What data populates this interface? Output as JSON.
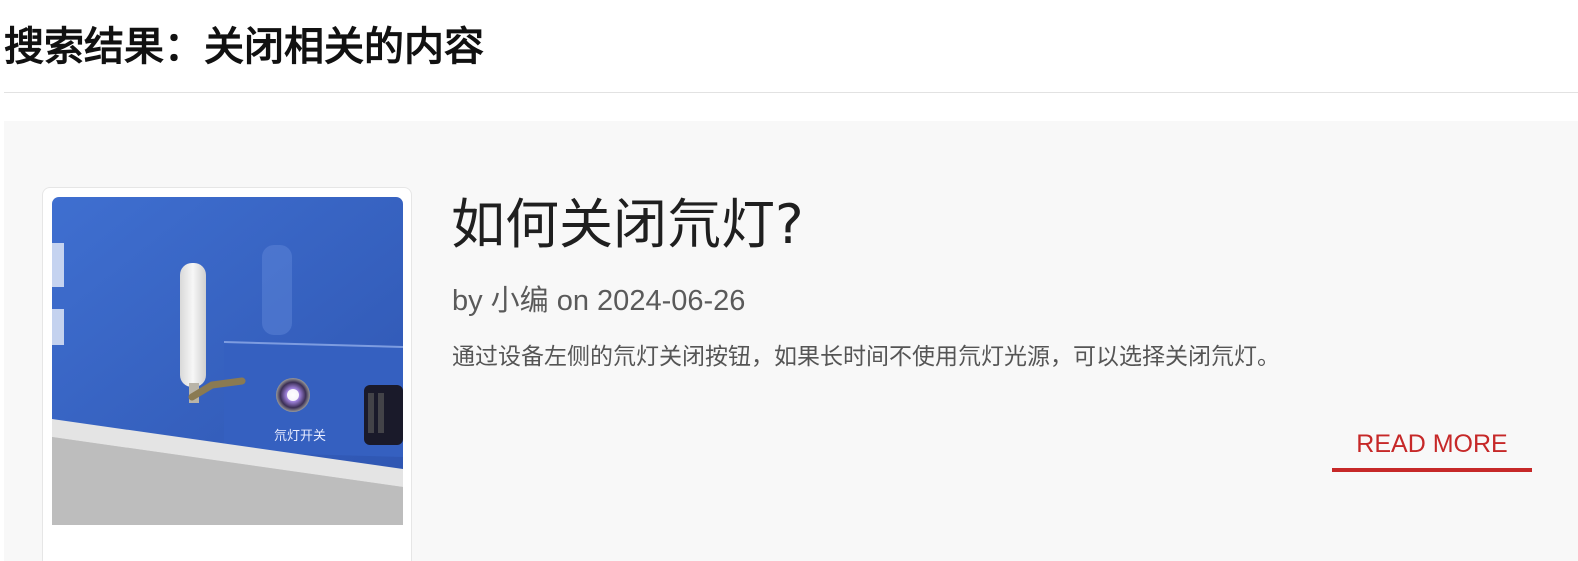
{
  "search": {
    "heading": "搜索结果：关闭相关的内容"
  },
  "result": {
    "title": "如何关闭氘灯?",
    "meta": "by 小编 on 2024-06-26",
    "excerpt": "通过设备左侧的氘灯关闭按钮，如果长时间不使用氘灯光源，可以选择关闭氘灯。",
    "read_more_label": "READ MORE",
    "thumbnail": {
      "device_label": "氘灯开关",
      "device_color": "#3a63c4",
      "icon": "device-photo"
    }
  },
  "colors": {
    "accent": "#c62828",
    "panel_background": "#f8f8f8"
  }
}
